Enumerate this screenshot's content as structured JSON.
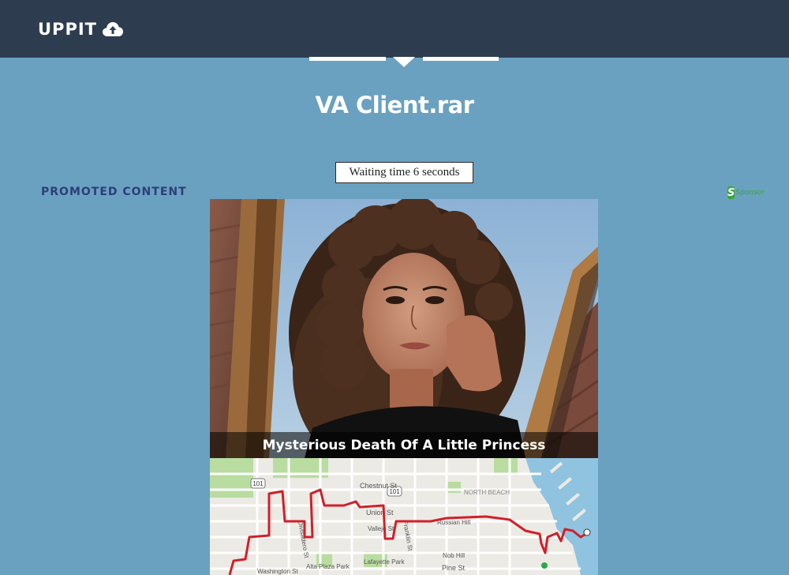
{
  "header": {
    "logo_text": "UPPIT",
    "logo_icon": "cloud-upload-icon"
  },
  "file": {
    "title": "VA Client.rar"
  },
  "download": {
    "wait_text": "Waiting time 6 seconds"
  },
  "promo": {
    "label": "PROMOTED CONTENT",
    "sponsor_letter": "S",
    "sponsor_text": "Sponsor",
    "items": [
      {
        "caption": "Mysterious Death Of A Little Princess",
        "image": "portrait-photo"
      },
      {
        "image": "street-map",
        "map_labels": [
          "101",
          "Chestnut St",
          "101",
          "Union St",
          "Vallejo St",
          "Franklin St",
          "Russian Hill",
          "NORTH BEACH",
          "Nob Hill",
          "Pine St",
          "Alta Plaza Park",
          "Lafayette Park",
          "Washington St",
          "Divisadero St"
        ]
      }
    ]
  },
  "colors": {
    "header_bg": "#2e3c50",
    "page_bg": "#6aa1c0",
    "promo_label": "#2c3e7a",
    "route": "#d0202a"
  }
}
